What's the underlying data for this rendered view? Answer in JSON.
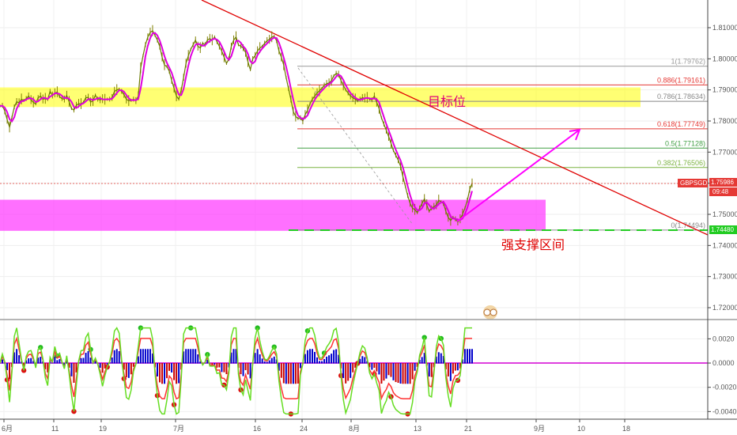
{
  "chart_data": [
    {
      "type": "line",
      "symbol": "GBPSGD",
      "last_price": "1.75986",
      "countdown": "09:48",
      "support_tag": "1.74480",
      "ylim": [
        1.7125,
        1.8125
      ],
      "y_ticks": [
        "1.81000",
        "1.80000",
        "1.79000",
        "1.78000",
        "1.77000",
        "1.76000",
        "1.75000",
        "1.74000",
        "1.73000",
        "1.72000"
      ],
      "y_tick_values": [
        1.81,
        1.8,
        1.79,
        1.78,
        1.77,
        1.76,
        1.75,
        1.74,
        1.73,
        1.72
      ],
      "x_labels": [
        "6月",
        "11",
        "19",
        "7月",
        "16",
        "24",
        "8月",
        "13",
        "21",
        "9月",
        "10",
        "18"
      ],
      "fib_levels": [
        {
          "ratio": "1",
          "value": "1.79762",
          "price": 1.79762,
          "color": "#999999"
        },
        {
          "ratio": "0.886",
          "value": "1.79161",
          "price": 1.79161,
          "color": "#e53935"
        },
        {
          "ratio": "0.786",
          "value": "1.78634",
          "price": 1.78634,
          "color": "#888888"
        },
        {
          "ratio": "0.618",
          "value": "1.77749",
          "price": 1.77749,
          "color": "#e53935"
        },
        {
          "ratio": "0.5",
          "value": "1.77128",
          "price": 1.77128,
          "color": "#43a047"
        },
        {
          "ratio": "0.382",
          "value": "1.76506",
          "price": 1.76506,
          "color": "#7cb342"
        },
        {
          "ratio": "0",
          "value": "1.74494",
          "price": 1.74494,
          "color": "#888888"
        }
      ],
      "zones": {
        "resistance": [
          1.7845,
          1.7908
        ],
        "support": [
          1.7447,
          1.7547
        ]
      },
      "annotations": {
        "target": "目标位",
        "support": "强支撑区间"
      },
      "price_path": [
        1.7848,
        1.785,
        1.7832,
        1.7805,
        1.778,
        1.7812,
        1.7845,
        1.7862,
        1.7858,
        1.787,
        1.7866,
        1.7872,
        1.788,
        1.7868,
        1.786,
        1.7855,
        1.7875,
        1.788,
        1.787,
        1.7872,
        1.7869,
        1.7895,
        1.7883,
        1.789,
        1.7893,
        1.7878,
        1.7872,
        1.787,
        1.7882,
        1.7862,
        1.784,
        1.7835,
        1.785,
        1.7856,
        1.7855,
        1.786,
        1.7875,
        1.7876,
        1.7861,
        1.7865,
        1.7883,
        1.787,
        1.7868,
        1.7871,
        1.7869,
        1.787,
        1.787,
        1.7875,
        1.7895,
        1.79,
        1.7902,
        1.7895,
        1.7885,
        1.787,
        1.7865,
        1.7866,
        1.787,
        1.7865,
        1.788,
        1.797,
        1.801,
        1.8045,
        1.807,
        1.8085,
        1.809,
        1.8075,
        1.806,
        1.804,
        1.8005,
        1.798,
        1.7975,
        1.796,
        1.793,
        1.7905,
        1.788,
        1.787,
        1.79,
        1.794,
        1.7985,
        1.801,
        1.803,
        1.8045,
        1.806,
        1.804,
        1.8035,
        1.805,
        1.8045,
        1.806,
        1.8065,
        1.806,
        1.807,
        1.8055,
        1.804,
        1.8025,
        1.8005,
        1.7985,
        1.8,
        1.804,
        1.806,
        1.807,
        1.8045,
        1.804,
        1.8035,
        1.802,
        1.799,
        1.7965,
        1.8,
        1.801,
        1.8025,
        1.8035,
        1.804,
        1.805,
        1.8058,
        1.8062,
        1.807,
        1.8072,
        1.8058,
        1.8025,
        1.8005,
        1.798,
        1.794,
        1.7905,
        1.787,
        1.783,
        1.7815,
        1.7808,
        1.781,
        1.78,
        1.782,
        1.7835,
        1.7855,
        1.787,
        1.788,
        1.789,
        1.7897,
        1.7905,
        1.7915,
        1.792,
        1.7922,
        1.793,
        1.7945,
        1.7953,
        1.795,
        1.793,
        1.7915,
        1.79,
        1.789,
        1.788,
        1.7875,
        1.787,
        1.7865,
        1.787,
        1.7875,
        1.7873,
        1.7875,
        1.787,
        1.7868,
        1.788,
        1.786,
        1.784,
        1.781,
        1.779,
        1.777,
        1.775,
        1.7728,
        1.7705,
        1.769,
        1.7675,
        1.7655,
        1.762,
        1.759,
        1.756,
        1.7535,
        1.752,
        1.7515,
        1.7505,
        1.752,
        1.7535,
        1.755,
        1.753,
        1.751,
        1.752,
        1.7525,
        1.753,
        1.7545,
        1.754,
        1.7535,
        1.751,
        1.749,
        1.748,
        1.749,
        1.7485,
        1.7475,
        1.7485,
        1.75,
        1.752,
        1.7545,
        1.758,
        1.76
      ]
    },
    {
      "type": "bar",
      "name": "oscillator",
      "ylim": [
        -0.0045,
        0.0032
      ],
      "y_ticks": [
        "0.0020",
        "0.0000",
        "-0.0020",
        "-0.0040"
      ],
      "y_tick_values": [
        0.002,
        0.0,
        -0.002,
        -0.004
      ],
      "zero_line_color": "#d400d4"
    }
  ]
}
